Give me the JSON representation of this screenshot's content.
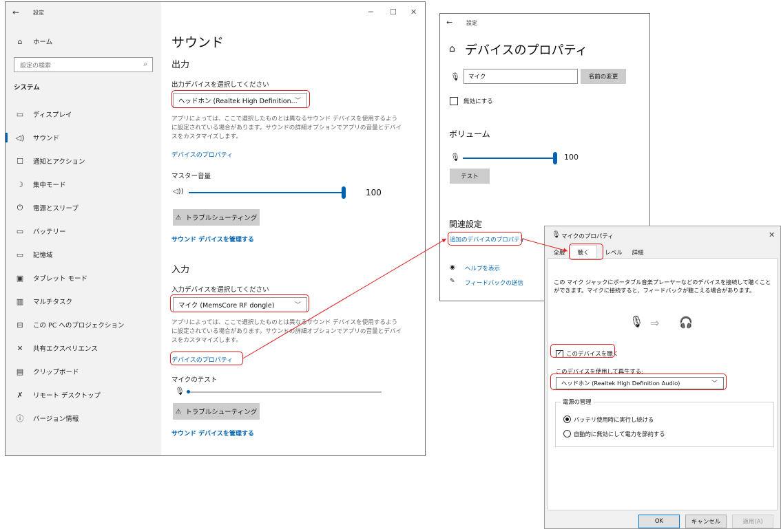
{
  "settings": {
    "title": "設定",
    "home": "ホーム",
    "search_placeholder": "設定の検索",
    "category": "システム",
    "nav": [
      {
        "label": "ディスプレイ",
        "icon": "display-icon"
      },
      {
        "label": "サウンド",
        "icon": "speaker-icon"
      },
      {
        "label": "通知とアクション",
        "icon": "notification-icon"
      },
      {
        "label": "集中モード",
        "icon": "moon-icon"
      },
      {
        "label": "電源とスリープ",
        "icon": "power-icon"
      },
      {
        "label": "バッテリー",
        "icon": "battery-icon"
      },
      {
        "label": "記憶域",
        "icon": "storage-icon"
      },
      {
        "label": "タブレット モード",
        "icon": "tablet-icon"
      },
      {
        "label": "マルチタスク",
        "icon": "multitask-icon"
      },
      {
        "label": "この PC へのプロジェクション",
        "icon": "projection-icon"
      },
      {
        "label": "共有エクスペリエンス",
        "icon": "share-icon"
      },
      {
        "label": "クリップボード",
        "icon": "clipboard-icon"
      },
      {
        "label": "リモート デスクトップ",
        "icon": "remote-icon"
      },
      {
        "label": "バージョン情報",
        "icon": "info-icon"
      }
    ],
    "sound": {
      "page_title": "サウンド",
      "output_title": "出力",
      "output_select_label": "出力デバイスを選択してください",
      "output_device": "ヘッドホン (Realtek High Definition...",
      "output_desc": "アプリによっては、ここで選択したものとは異なるサウンド デバイスを使用するように設定されている場合があります。サウンドの詳細オプションでアプリの音量とデバイスをカスタマイズします。",
      "output_props_link": "デバイスのプロパティ",
      "master_volume_label": "マスター音量",
      "master_volume": "100",
      "master_volume_value": 100,
      "troubleshoot": "トラブルシューティング",
      "manage_link": "サウンド デバイスを管理する",
      "input_title": "入力",
      "input_select_label": "入力デバイスを選択してください",
      "input_device": "マイク (MemsCore RF dongle)",
      "input_desc": "アプリによっては、ここで選択したものとは異なるサウンド デバイスを使用するように設定されている場合があります。サウンドの詳細オプションでアプリの音量とデバイスをカスタマイズします。",
      "input_props_link": "デバイスのプロパティ",
      "mic_test_label": "マイクのテスト",
      "troubleshoot2": "トラブルシューティング",
      "manage_link2": "サウンド デバイスを管理する"
    }
  },
  "device_props": {
    "title": "設定",
    "page_title": "デバイスのプロパティ",
    "name_value": "マイク",
    "rename_button": "名前の変更",
    "disable_label": "無効にする",
    "volume_title": "ボリューム",
    "volume": "100",
    "volume_value": 100,
    "test_button": "テスト",
    "related_title": "関連設定",
    "additional_link": "追加のデバイスのプロパティ",
    "help_link": "ヘルプを表示",
    "feedback_link": "フィードバックの送信"
  },
  "mic_dialog": {
    "title": "マイクのプロパティ",
    "tabs": [
      "全般",
      "聴く",
      "レベル",
      "詳細"
    ],
    "listen_desc": "この マイク ジャックにポータブル音楽プレーヤーなどのデバイスを接続して聴くことができます。マイクに接続すると、フィードバックが聴こえる場合があります。",
    "listen_checkbox": "このデバイスを聴く",
    "playback_label": "このデバイスを使用して再生する:",
    "playback_device": "ヘッドホン (Realtek High Definition Audio)",
    "power_group": "電源の管理",
    "radio_battery": "バッテリ使用時に実行し続ける",
    "radio_auto": "自動的に無効にして電力を節約する",
    "ok": "OK",
    "cancel": "キャンセル",
    "apply": "適用(A)"
  },
  "colors": {
    "accent": "#0063b1",
    "highlight": "#e02020"
  }
}
